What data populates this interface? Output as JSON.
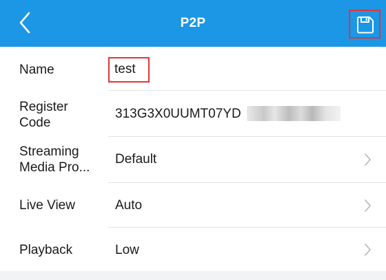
{
  "header": {
    "title": "P2P",
    "back_icon": "chevron-left-icon",
    "save_icon": "floppy-disk-icon",
    "background": "#1c97e5",
    "highlight_color": "#e0353a"
  },
  "rows": [
    {
      "label": "Name",
      "value": "test",
      "editable": true
    },
    {
      "label_line1": "Register",
      "label_line2": "Code",
      "value": "313G3X0UUMT07YD"
    },
    {
      "label_line1": "Streaming",
      "label_line2": "Media Pro...",
      "value": "Default",
      "chevron": "chevron-right-icon"
    },
    {
      "label": "Live View",
      "value": "Auto",
      "chevron": "chevron-right-icon"
    },
    {
      "label": "Playback",
      "value": "Low",
      "chevron": "chevron-right-icon"
    }
  ]
}
